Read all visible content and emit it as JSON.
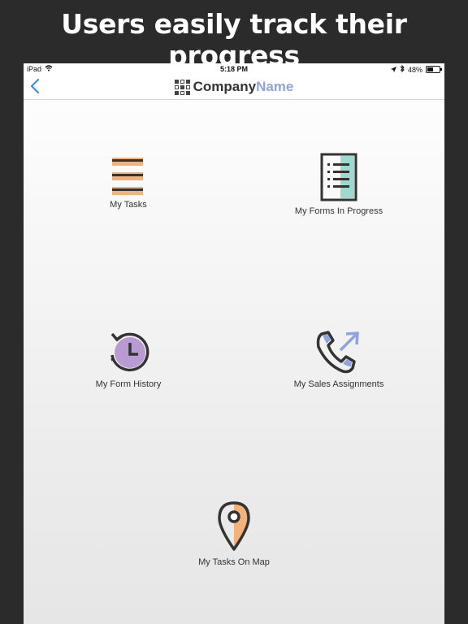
{
  "headline": "Users easily track their progress",
  "status": {
    "device": "iPad",
    "time": "5:18 PM",
    "battery": "48%",
    "battery_level": 0.48
  },
  "nav": {
    "back_icon": "chevron-left-icon",
    "brand_first": "Company",
    "brand_second": "Name"
  },
  "tiles": [
    {
      "label": "My Tasks",
      "icon": "list-icon"
    },
    {
      "label": "My Forms In Progress",
      "icon": "form-icon"
    },
    {
      "label": "My Form History",
      "icon": "history-clock-icon"
    },
    {
      "label": "My Sales Assignments",
      "icon": "phone-outgoing-icon"
    },
    {
      "label": "My Tasks On Map",
      "icon": "map-pin-icon"
    }
  ],
  "colors": {
    "accent_blue": "#3b8ee6",
    "brand_name": "#8fa3d8",
    "orange": "#f2b27a",
    "teal": "#9ed8cf",
    "purple": "#b99bd3",
    "periwinkle": "#8fa3e0"
  }
}
